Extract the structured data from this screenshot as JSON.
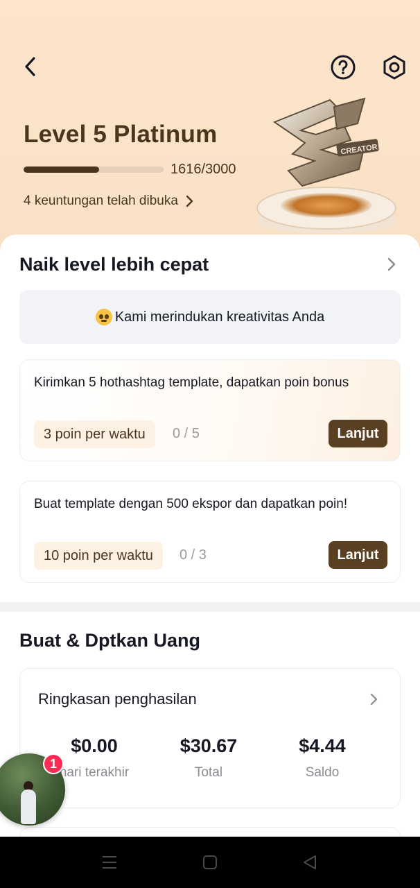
{
  "header": {
    "back_icon": "chevron-left-icon",
    "help_icon": "question-circle-icon",
    "settings_icon": "hexagon-gear-icon"
  },
  "level": {
    "title": "Level 5 Platinum",
    "progress_text": "1616/3000",
    "progress_fraction": 0.539,
    "benefits": "4 keuntungan telah dibuka",
    "badge_icon": "creator-trophy-icon",
    "badge_lettering": "CREATOR"
  },
  "level_up": {
    "title": "Naik level lebih cepat",
    "notice": "Kami merindukan kreativitas Anda",
    "tasks": [
      {
        "text": "Kirimkan 5 hothashtag template, dapatkan poin bonus",
        "points": "3 poin per waktu",
        "count": "0 / 5",
        "button": "Lanjut"
      },
      {
        "text": "Buat template dengan 500 ekspor dan dapatkan poin!",
        "points": "10 poin per waktu",
        "count": "0 / 3",
        "button": "Lanjut"
      }
    ]
  },
  "earn": {
    "title": "Buat & Dptkan Uang",
    "summary_title": "Ringkasan penghasilan",
    "stats": [
      {
        "value": "$0.00",
        "label": "hari terakhir"
      },
      {
        "value": "$30.67",
        "label": "Total"
      },
      {
        "value": "$4.44",
        "label": "Saldo"
      }
    ]
  },
  "floating": {
    "badge_count": "1"
  },
  "colors": {
    "accent_brown": "#4a3520",
    "button_brown": "#5a4022",
    "badge_red": "#fe2c55",
    "hero_bg": "#fde5cc"
  }
}
